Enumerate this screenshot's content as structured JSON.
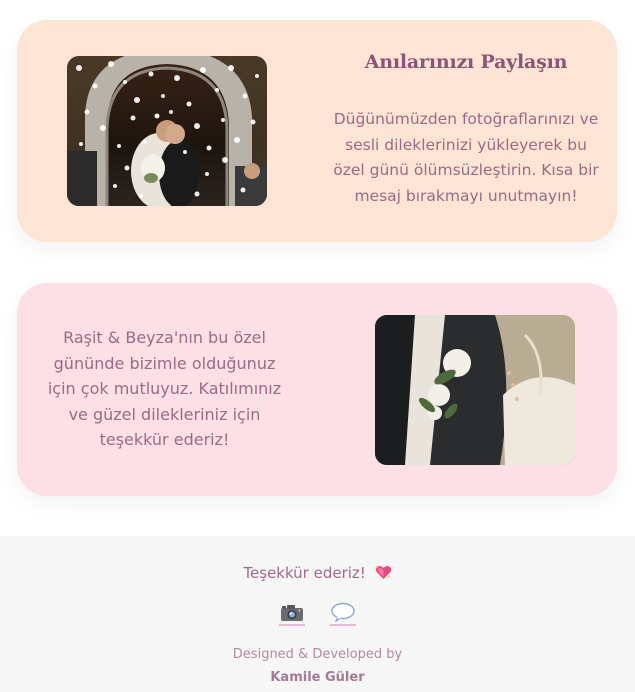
{
  "memories_card": {
    "title": "Anılarınızı Paylaşın",
    "text": "Düğünümüzden fotoğraflarınızı ve sesli dileklerinizi yükleyerek bu özel günü ölümsüzleştirin. Kısa bir mesaj bırakmayı unutmayın!",
    "photo_icon": "wedding-petals-photo"
  },
  "thanks_card": {
    "text": "Raşit & Beyza'nın bu özel gününde bizimle olduğunuz için çok mutluyuz. Katılımınız ve güzel dilekleriniz için teşekkür ederiz!",
    "photo_icon": "boutonniere-photo"
  },
  "footer": {
    "thanks_text": "Teşekkür ederiz!",
    "heart_icon": "sparkling-heart-icon",
    "links": [
      {
        "icon": "camera-icon"
      },
      {
        "icon": "speech-bubble-icon"
      }
    ],
    "designed_by": "Designed & Developed by",
    "author": "Kamile Güler"
  },
  "colors": {
    "peach_card": "#fde5d5",
    "pink_card": "#fde0e5",
    "title": "#8b5478",
    "text": "#9a6a86",
    "footer_bg": "#f6f6f6"
  }
}
